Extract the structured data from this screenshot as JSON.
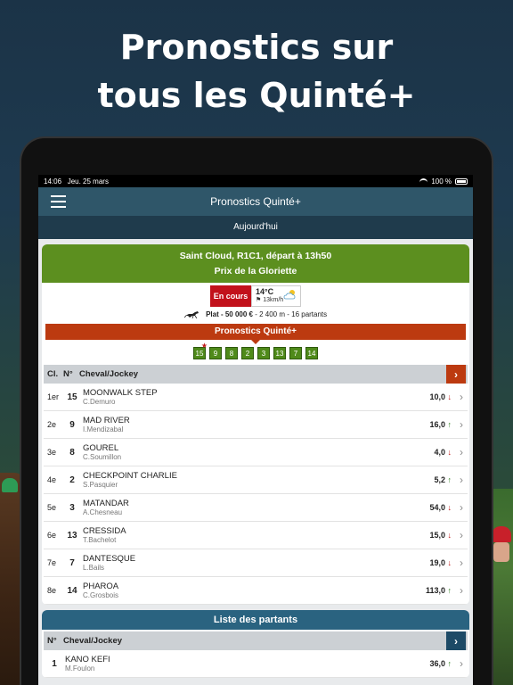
{
  "promo": {
    "line1": "Pronostics sur",
    "line2": "tous les Quinté+"
  },
  "statusbar": {
    "time": "14:06",
    "date": "Jeu. 25 mars",
    "battery": "100 %"
  },
  "navbar": {
    "title": "Pronostics Quinté+"
  },
  "day_label": "Aujourd'hui",
  "race": {
    "line1": "Saint Cloud, R1C1, départ à 13h50",
    "line2": "Prix de la Gloriette",
    "status": "En cours",
    "temperature": "14°C",
    "wind": "13km/h",
    "info_bold": "Plat - 50 000 €",
    "info_rest": " - 2 400 m - 16 partants"
  },
  "prono": {
    "title": "Pronostics Quinté+",
    "numbers": [
      "15",
      "9",
      "8",
      "2",
      "3",
      "13",
      "7",
      "14"
    ],
    "starred_index": 0
  },
  "ranking": {
    "header": {
      "cl": "Cl.",
      "no": "N°",
      "title": "Cheval/Jockey"
    },
    "rows": [
      {
        "rank": "1er",
        "num": "15",
        "horse": "MOONWALK STEP",
        "jockey": "C.Demuro",
        "odds": "10,0",
        "trend": "down"
      },
      {
        "rank": "2e",
        "num": "9",
        "horse": "MAD RIVER",
        "jockey": "I.Mendizabal",
        "odds": "16,0",
        "trend": "up"
      },
      {
        "rank": "3e",
        "num": "8",
        "horse": "GOUREL",
        "jockey": "C.Soumillon",
        "odds": "4,0",
        "trend": "down"
      },
      {
        "rank": "4e",
        "num": "2",
        "horse": "CHECKPOINT CHARLIE",
        "jockey": "S.Pasquier",
        "odds": "5,2",
        "trend": "up"
      },
      {
        "rank": "5e",
        "num": "3",
        "horse": "MATANDAR",
        "jockey": "A.Chesneau",
        "odds": "54,0",
        "trend": "down"
      },
      {
        "rank": "6e",
        "num": "13",
        "horse": "CRESSIDA",
        "jockey": "T.Bachelot",
        "odds": "15,0",
        "trend": "down"
      },
      {
        "rank": "7e",
        "num": "7",
        "horse": "DANTESQUE",
        "jockey": "L.Bails",
        "odds": "19,0",
        "trend": "down"
      },
      {
        "rank": "8e",
        "num": "14",
        "horse": "PHAROA",
        "jockey": "C.Grosbois",
        "odds": "113,0",
        "trend": "up"
      }
    ]
  },
  "partants": {
    "title": "Liste des partants",
    "header": {
      "no": "N°",
      "title": "Cheval/Jockey"
    },
    "rows": [
      {
        "num": "1",
        "horse": "KANO KEFI",
        "jockey": "M.Foulon",
        "odds": "36,0",
        "trend": "up"
      }
    ]
  },
  "icons": {
    "menu": "hamburger-icon",
    "weather": "partly-cloudy-icon",
    "wind": "flag-icon",
    "discipline": "galloping-horse-icon",
    "chevron": "chevron-right-icon",
    "trend_up": "arrow-up-icon",
    "trend_down": "arrow-down-icon"
  },
  "colors": {
    "race_header": "#5c8f1f",
    "prono_band": "#bc3a10",
    "status_live": "#c2111b",
    "nav": "#2f5669",
    "up": "#2e7d1f",
    "down": "#c21919"
  }
}
